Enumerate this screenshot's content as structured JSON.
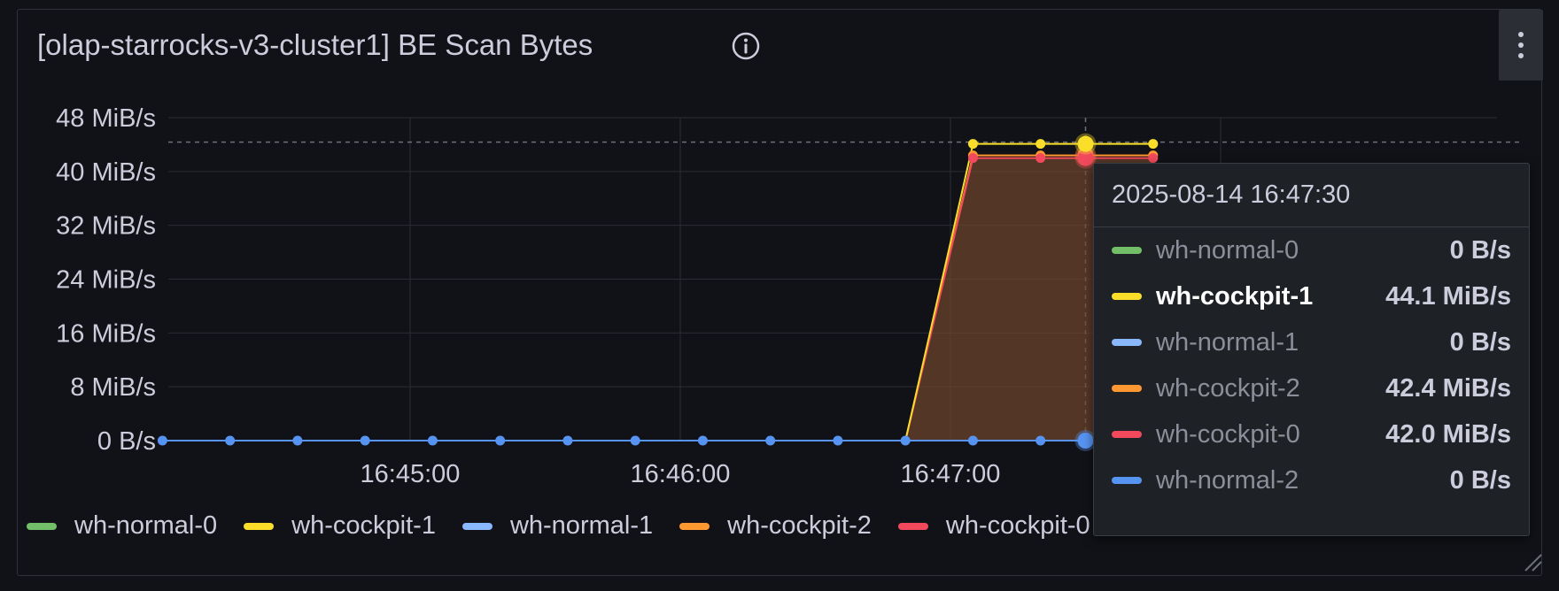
{
  "panel": {
    "title": "[olap-starrocks-v3-cluster1] BE Scan Bytes",
    "info_icon": "info-circle-icon",
    "menu_icon": "kebab-menu-icon"
  },
  "chart_data": {
    "type": "line",
    "y_ticks": [
      "0 B/s",
      "8 MiB/s",
      "16 MiB/s",
      "24 MiB/s",
      "32 MiB/s",
      "40 MiB/s",
      "48 MiB/s"
    ],
    "ylim": [
      0,
      48
    ],
    "y_unit": "MiB/s",
    "x_ticks": [
      "16:45:00",
      "16:46:00",
      "16:47:00"
    ],
    "x": [
      "16:44:05",
      "16:44:20",
      "16:44:35",
      "16:44:50",
      "16:45:05",
      "16:45:20",
      "16:45:35",
      "16:45:50",
      "16:46:05",
      "16:46:20",
      "16:46:35",
      "16:46:50",
      "16:47:05",
      "16:47:20",
      "16:47:30",
      "16:47:45"
    ],
    "grid": true,
    "series": [
      {
        "name": "wh-normal-0",
        "color": "#73bf69",
        "values": [
          0,
          0,
          0,
          0,
          0,
          0,
          0,
          0,
          0,
          0,
          0,
          0,
          0,
          0,
          0,
          0
        ]
      },
      {
        "name": "wh-cockpit-1",
        "color": "#fade2a",
        "values": [
          0,
          0,
          0,
          0,
          0,
          0,
          0,
          0,
          0,
          0,
          0,
          0,
          44.1,
          44.1,
          44.1,
          44.1
        ]
      },
      {
        "name": "wh-normal-1",
        "color": "#8ab8ff",
        "values": [
          0,
          0,
          0,
          0,
          0,
          0,
          0,
          0,
          0,
          0,
          0,
          0,
          0,
          0,
          0,
          0
        ]
      },
      {
        "name": "wh-cockpit-2",
        "color": "#ff9830",
        "values": [
          0,
          0,
          0,
          0,
          0,
          0,
          0,
          0,
          0,
          0,
          0,
          0,
          42.4,
          42.4,
          42.4,
          42.4
        ]
      },
      {
        "name": "wh-cockpit-0",
        "color": "#f2495c",
        "values": [
          0,
          0,
          0,
          0,
          0,
          0,
          0,
          0,
          0,
          0,
          0,
          0,
          42.0,
          42.0,
          42.0,
          42.0
        ]
      },
      {
        "name": "wh-normal-2",
        "color": "#5794f2",
        "values": [
          0,
          0,
          0,
          0,
          0,
          0,
          0,
          0,
          0,
          0,
          0,
          0,
          0,
          0,
          0,
          0
        ]
      }
    ],
    "hover_index": 14,
    "threshold_line": 44.1
  },
  "tooltip": {
    "time": "2025-08-14 16:47:30",
    "rows": [
      {
        "name": "wh-normal-0",
        "value": "0 B/s",
        "color": "#73bf69",
        "active": false
      },
      {
        "name": "wh-cockpit-1",
        "value": "44.1 MiB/s",
        "color": "#fade2a",
        "active": true
      },
      {
        "name": "wh-normal-1",
        "value": "0 B/s",
        "color": "#8ab8ff",
        "active": false
      },
      {
        "name": "wh-cockpit-2",
        "value": "42.4 MiB/s",
        "color": "#ff9830",
        "active": false
      },
      {
        "name": "wh-cockpit-0",
        "value": "42.0 MiB/s",
        "color": "#f2495c",
        "active": false
      },
      {
        "name": "wh-normal-2",
        "value": "0 B/s",
        "color": "#5794f2",
        "active": false
      }
    ]
  },
  "legend": {
    "items": [
      {
        "name": "wh-normal-0",
        "color": "#73bf69"
      },
      {
        "name": "wh-cockpit-1",
        "color": "#fade2a"
      },
      {
        "name": "wh-normal-1",
        "color": "#8ab8ff"
      },
      {
        "name": "wh-cockpit-2",
        "color": "#ff9830"
      },
      {
        "name": "wh-cockpit-0",
        "color": "#f2495c"
      }
    ]
  }
}
